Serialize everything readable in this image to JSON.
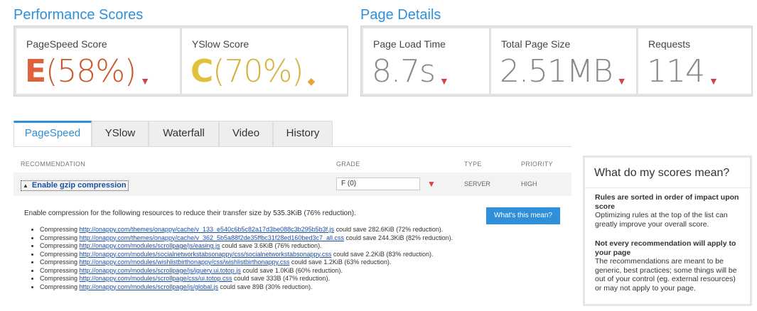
{
  "performance": {
    "title": "Performance Scores",
    "pagespeed": {
      "label": "PageSpeed Score",
      "grade": "E",
      "percent": "(58%)",
      "color": "#e0623a"
    },
    "yslow": {
      "label": "YSlow Score",
      "grade": "C",
      "percent": "(70%)",
      "color": "#e0c23a"
    }
  },
  "details": {
    "title": "Page Details",
    "load_time": {
      "label": "Page Load Time",
      "value": "8.7s"
    },
    "page_size": {
      "label": "Total Page Size",
      "value": "2.51MB"
    },
    "requests": {
      "label": "Requests",
      "value": "114"
    }
  },
  "tabs": [
    "PageSpeed",
    "YSlow",
    "Waterfall",
    "Video",
    "History"
  ],
  "table": {
    "headers": {
      "recommendation": "RECOMMENDATION",
      "grade": "GRADE",
      "type": "TYPE",
      "priority": "PRIORITY"
    },
    "row": {
      "name": "Enable gzip compression",
      "grade": "F (0)",
      "type": "SERVER",
      "priority": "HIGH"
    },
    "intro": "Enable compression for the following resources to reduce their transfer size by 535.3KiB (76% reduction).",
    "button": "What's this mean?",
    "resources": [
      {
        "prefix": "Compressing ",
        "url": "http://onappy.com/themes/onappy/cache/v_133_e540c6b5c82a17d3be088c3b295b5b3f.js",
        "suffix": " could save 282.6KiB (72% reduction)."
      },
      {
        "prefix": "Compressing ",
        "url": "http://onappy.com/themes/onappy/cache/v_362_5b5a88f2de35ffbc31f28ed160bed3c7_all.css",
        "suffix": " could save 244.3KiB (82% reduction)."
      },
      {
        "prefix": "Compressing ",
        "url": "http://onappy.com/modules/scrollpage/js/easing.js",
        "suffix": " could save 3.6KiB (76% reduction)."
      },
      {
        "prefix": "Compressing ",
        "url": "http://onappy.com/modules/socialnetworkstabsonappy/css/socialnetworkstabsonappy.css",
        "suffix": " could save 2.2KiB (83% reduction)."
      },
      {
        "prefix": "Compressing ",
        "url": "http://onappy.com/modules/wishlistbirthonappy/css/wishlistbirthonappy.css",
        "suffix": " could save 1.2KiB (63% reduction)."
      },
      {
        "prefix": "Compressing ",
        "url": "http://onappy.com/modules/scrollpage/js/jquery.ui.totop.js",
        "suffix": " could save 1.0KiB (60% reduction)."
      },
      {
        "prefix": "Compressing ",
        "url": "http://onappy.com/modules/scrollpage/css/ui.totop.css",
        "suffix": " could save 333B (47% reduction)."
      },
      {
        "prefix": "Compressing ",
        "url": "http://onappy.com/modules/scrollpage/js/global.js",
        "suffix": " could save 89B (30% reduction)."
      }
    ]
  },
  "sidebar": {
    "title": "What do my scores mean?",
    "block1_title": "Rules are sorted in order of impact upon score",
    "block1_text": "Optimizing rules at the top of the list can greatly improve your overall score.",
    "block2_title": "Not every recommendation will apply to your page",
    "block2_text": "The recommendations are meant to be generic, best practices; some things will be out of your control (eg. external resources) or may not apply to your page."
  },
  "icons": {
    "down_caret": "caret-down-icon",
    "diamond": "diamond-icon",
    "collapse_triangle": "triangle-up-icon"
  },
  "colors": {
    "accent": "#2f8fd8",
    "caret_red": "#d34545",
    "caret_orange": "#e8a53a"
  }
}
